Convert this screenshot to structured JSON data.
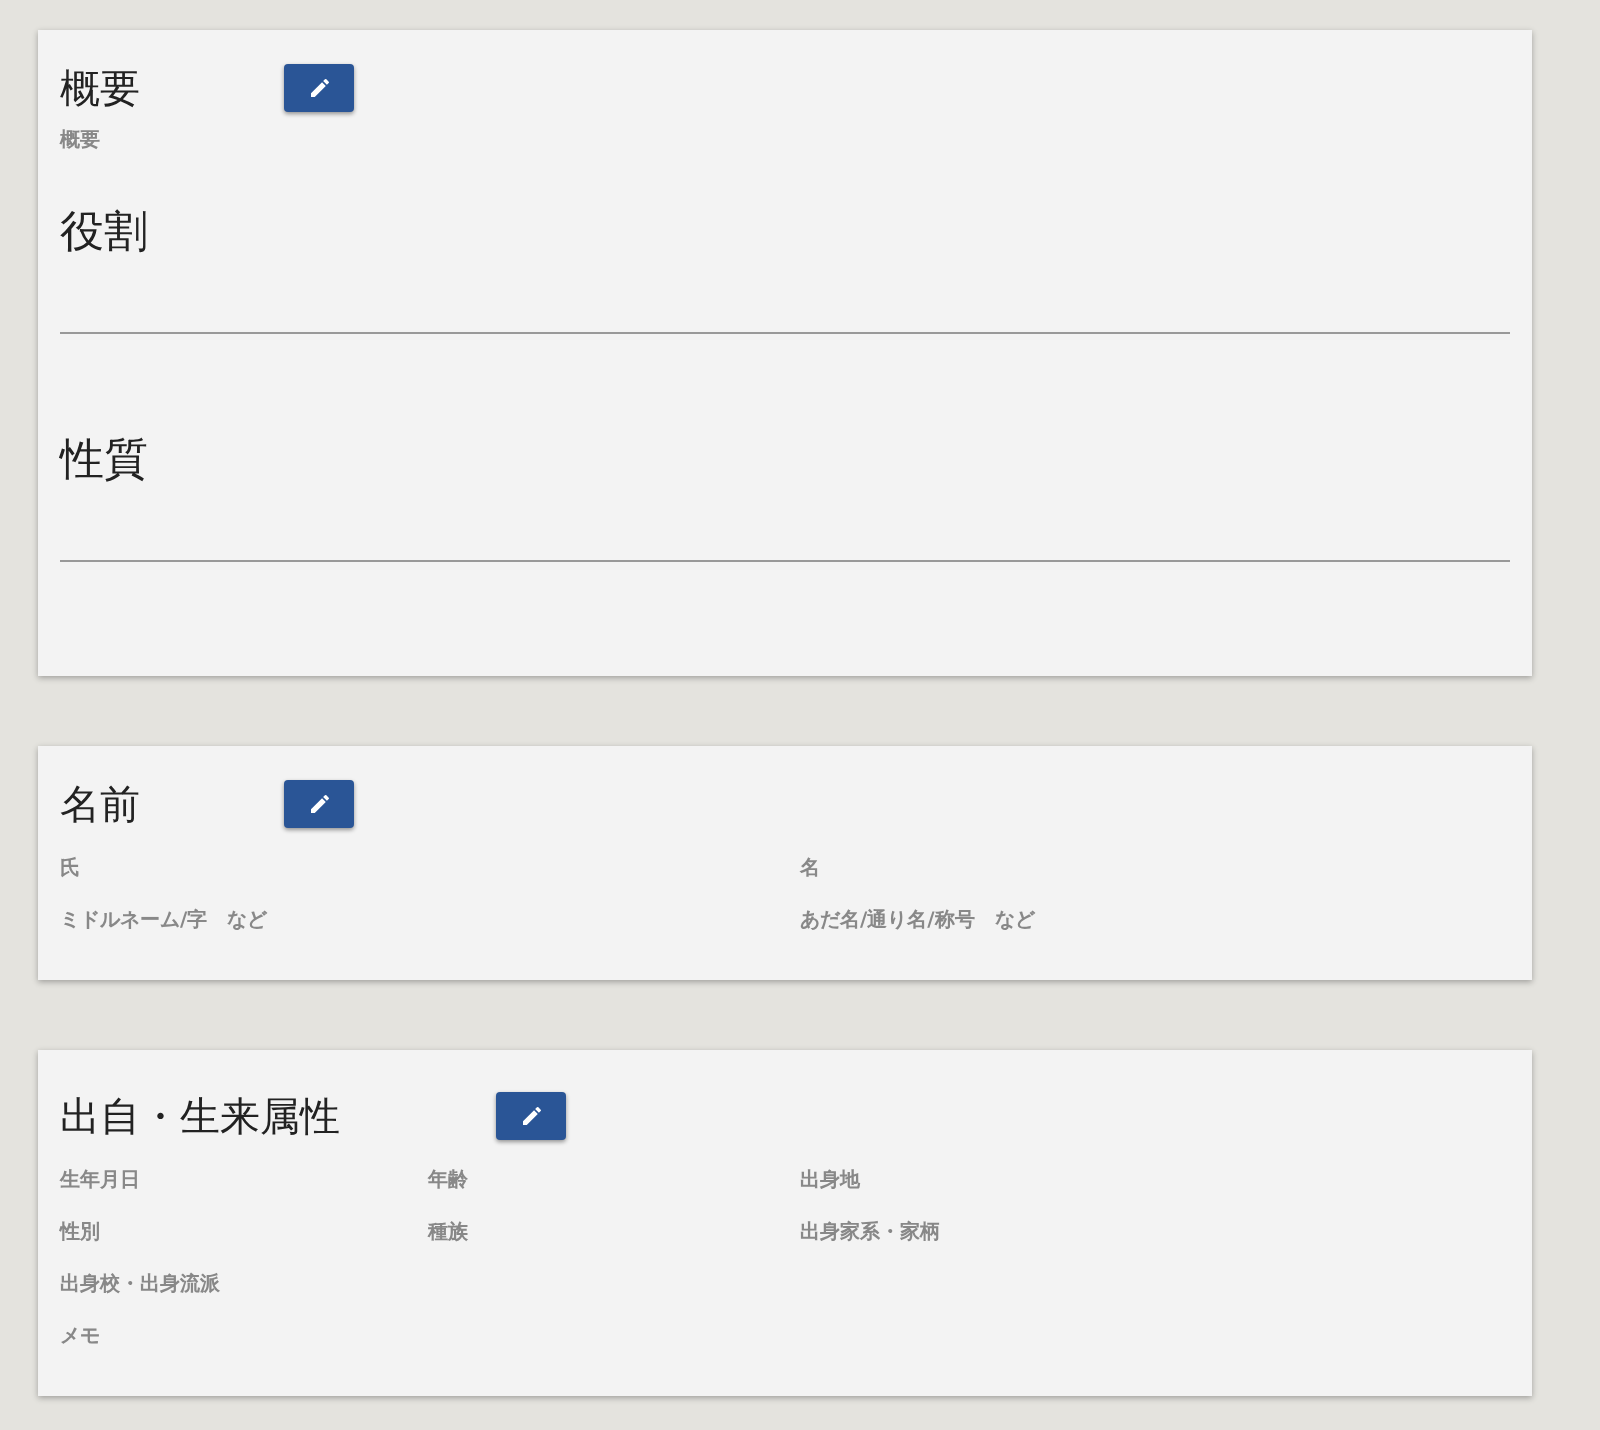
{
  "cards": [
    {
      "kind": "overview",
      "title": "概要",
      "subtitle": "概要",
      "fields": [
        {
          "label": "役割"
        },
        {
          "label": "性質"
        }
      ]
    },
    {
      "kind": "halves",
      "title": "名前",
      "rows": [
        [
          "氏",
          "名"
        ],
        [
          "ミドルネーム/字　など",
          "あだ名/通り名/称号　など"
        ]
      ]
    },
    {
      "kind": "thirds",
      "title": "出自・生来属性",
      "rows": [
        [
          "生年月日",
          "年齢",
          "出身地"
        ],
        [
          "性別",
          "種族",
          "出身家系・家柄"
        ],
        [
          "出身校・出身流派"
        ],
        [
          "メモ"
        ]
      ]
    }
  ]
}
